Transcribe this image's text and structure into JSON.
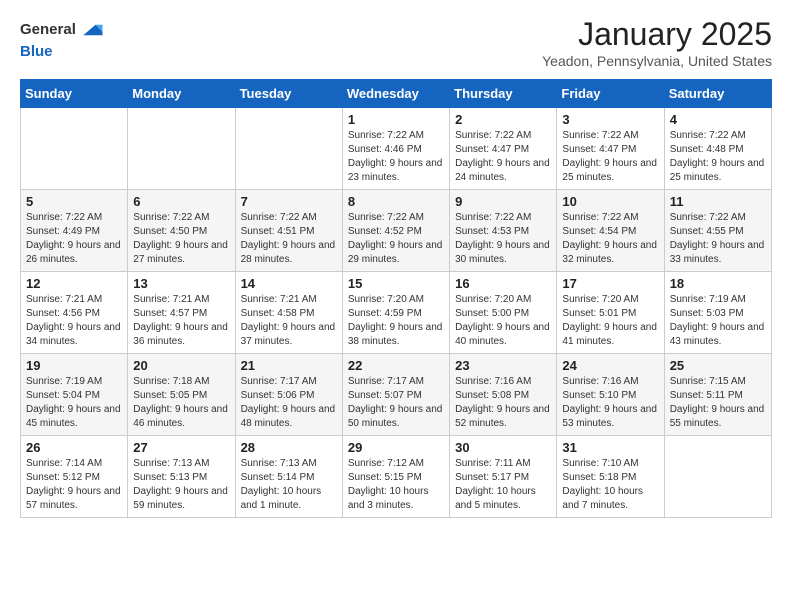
{
  "header": {
    "logo_line1": "General",
    "logo_line2": "Blue",
    "month_year": "January 2025",
    "location": "Yeadon, Pennsylvania, United States"
  },
  "days_of_week": [
    "Sunday",
    "Monday",
    "Tuesday",
    "Wednesday",
    "Thursday",
    "Friday",
    "Saturday"
  ],
  "weeks": [
    [
      {
        "day": "",
        "sunrise": "",
        "sunset": "",
        "daylight": ""
      },
      {
        "day": "",
        "sunrise": "",
        "sunset": "",
        "daylight": ""
      },
      {
        "day": "",
        "sunrise": "",
        "sunset": "",
        "daylight": ""
      },
      {
        "day": "1",
        "sunrise": "Sunrise: 7:22 AM",
        "sunset": "Sunset: 4:46 PM",
        "daylight": "Daylight: 9 hours and 23 minutes."
      },
      {
        "day": "2",
        "sunrise": "Sunrise: 7:22 AM",
        "sunset": "Sunset: 4:47 PM",
        "daylight": "Daylight: 9 hours and 24 minutes."
      },
      {
        "day": "3",
        "sunrise": "Sunrise: 7:22 AM",
        "sunset": "Sunset: 4:47 PM",
        "daylight": "Daylight: 9 hours and 25 minutes."
      },
      {
        "day": "4",
        "sunrise": "Sunrise: 7:22 AM",
        "sunset": "Sunset: 4:48 PM",
        "daylight": "Daylight: 9 hours and 25 minutes."
      }
    ],
    [
      {
        "day": "5",
        "sunrise": "Sunrise: 7:22 AM",
        "sunset": "Sunset: 4:49 PM",
        "daylight": "Daylight: 9 hours and 26 minutes."
      },
      {
        "day": "6",
        "sunrise": "Sunrise: 7:22 AM",
        "sunset": "Sunset: 4:50 PM",
        "daylight": "Daylight: 9 hours and 27 minutes."
      },
      {
        "day": "7",
        "sunrise": "Sunrise: 7:22 AM",
        "sunset": "Sunset: 4:51 PM",
        "daylight": "Daylight: 9 hours and 28 minutes."
      },
      {
        "day": "8",
        "sunrise": "Sunrise: 7:22 AM",
        "sunset": "Sunset: 4:52 PM",
        "daylight": "Daylight: 9 hours and 29 minutes."
      },
      {
        "day": "9",
        "sunrise": "Sunrise: 7:22 AM",
        "sunset": "Sunset: 4:53 PM",
        "daylight": "Daylight: 9 hours and 30 minutes."
      },
      {
        "day": "10",
        "sunrise": "Sunrise: 7:22 AM",
        "sunset": "Sunset: 4:54 PM",
        "daylight": "Daylight: 9 hours and 32 minutes."
      },
      {
        "day": "11",
        "sunrise": "Sunrise: 7:22 AM",
        "sunset": "Sunset: 4:55 PM",
        "daylight": "Daylight: 9 hours and 33 minutes."
      }
    ],
    [
      {
        "day": "12",
        "sunrise": "Sunrise: 7:21 AM",
        "sunset": "Sunset: 4:56 PM",
        "daylight": "Daylight: 9 hours and 34 minutes."
      },
      {
        "day": "13",
        "sunrise": "Sunrise: 7:21 AM",
        "sunset": "Sunset: 4:57 PM",
        "daylight": "Daylight: 9 hours and 36 minutes."
      },
      {
        "day": "14",
        "sunrise": "Sunrise: 7:21 AM",
        "sunset": "Sunset: 4:58 PM",
        "daylight": "Daylight: 9 hours and 37 minutes."
      },
      {
        "day": "15",
        "sunrise": "Sunrise: 7:20 AM",
        "sunset": "Sunset: 4:59 PM",
        "daylight": "Daylight: 9 hours and 38 minutes."
      },
      {
        "day": "16",
        "sunrise": "Sunrise: 7:20 AM",
        "sunset": "Sunset: 5:00 PM",
        "daylight": "Daylight: 9 hours and 40 minutes."
      },
      {
        "day": "17",
        "sunrise": "Sunrise: 7:20 AM",
        "sunset": "Sunset: 5:01 PM",
        "daylight": "Daylight: 9 hours and 41 minutes."
      },
      {
        "day": "18",
        "sunrise": "Sunrise: 7:19 AM",
        "sunset": "Sunset: 5:03 PM",
        "daylight": "Daylight: 9 hours and 43 minutes."
      }
    ],
    [
      {
        "day": "19",
        "sunrise": "Sunrise: 7:19 AM",
        "sunset": "Sunset: 5:04 PM",
        "daylight": "Daylight: 9 hours and 45 minutes."
      },
      {
        "day": "20",
        "sunrise": "Sunrise: 7:18 AM",
        "sunset": "Sunset: 5:05 PM",
        "daylight": "Daylight: 9 hours and 46 minutes."
      },
      {
        "day": "21",
        "sunrise": "Sunrise: 7:17 AM",
        "sunset": "Sunset: 5:06 PM",
        "daylight": "Daylight: 9 hours and 48 minutes."
      },
      {
        "day": "22",
        "sunrise": "Sunrise: 7:17 AM",
        "sunset": "Sunset: 5:07 PM",
        "daylight": "Daylight: 9 hours and 50 minutes."
      },
      {
        "day": "23",
        "sunrise": "Sunrise: 7:16 AM",
        "sunset": "Sunset: 5:08 PM",
        "daylight": "Daylight: 9 hours and 52 minutes."
      },
      {
        "day": "24",
        "sunrise": "Sunrise: 7:16 AM",
        "sunset": "Sunset: 5:10 PM",
        "daylight": "Daylight: 9 hours and 53 minutes."
      },
      {
        "day": "25",
        "sunrise": "Sunrise: 7:15 AM",
        "sunset": "Sunset: 5:11 PM",
        "daylight": "Daylight: 9 hours and 55 minutes."
      }
    ],
    [
      {
        "day": "26",
        "sunrise": "Sunrise: 7:14 AM",
        "sunset": "Sunset: 5:12 PM",
        "daylight": "Daylight: 9 hours and 57 minutes."
      },
      {
        "day": "27",
        "sunrise": "Sunrise: 7:13 AM",
        "sunset": "Sunset: 5:13 PM",
        "daylight": "Daylight: 9 hours and 59 minutes."
      },
      {
        "day": "28",
        "sunrise": "Sunrise: 7:13 AM",
        "sunset": "Sunset: 5:14 PM",
        "daylight": "Daylight: 10 hours and 1 minute."
      },
      {
        "day": "29",
        "sunrise": "Sunrise: 7:12 AM",
        "sunset": "Sunset: 5:15 PM",
        "daylight": "Daylight: 10 hours and 3 minutes."
      },
      {
        "day": "30",
        "sunrise": "Sunrise: 7:11 AM",
        "sunset": "Sunset: 5:17 PM",
        "daylight": "Daylight: 10 hours and 5 minutes."
      },
      {
        "day": "31",
        "sunrise": "Sunrise: 7:10 AM",
        "sunset": "Sunset: 5:18 PM",
        "daylight": "Daylight: 10 hours and 7 minutes."
      },
      {
        "day": "",
        "sunrise": "",
        "sunset": "",
        "daylight": ""
      }
    ]
  ]
}
